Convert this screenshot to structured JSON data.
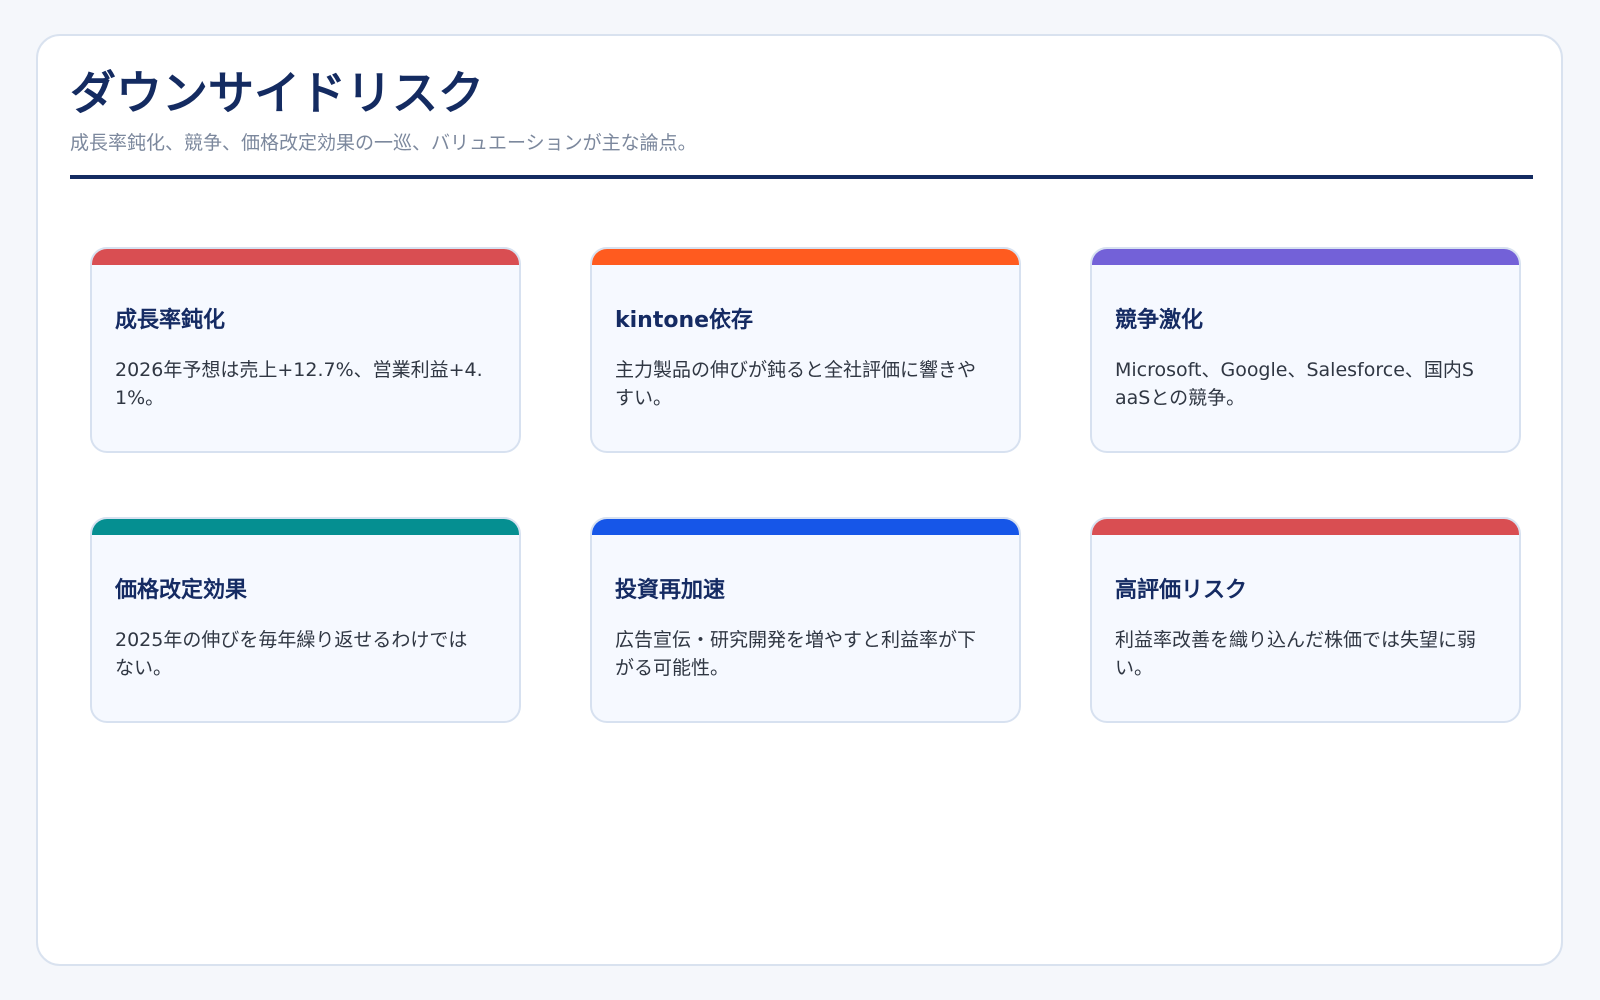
{
  "page": {
    "title": "ダウンサイドリスク",
    "subtitle": "成長率鈍化、競争、価格改定効果の一巡、バリュエーションが主な論点。"
  },
  "colors": {
    "background": "#f5f7fb",
    "panel": "#ffffff",
    "title": "#142b61",
    "subtitle": "#7c889d",
    "card_background": "#f6f9ff",
    "card_border": "#d7e1f0"
  },
  "cards": [
    {
      "title": "成長率鈍化",
      "body": "2026年予想は売上+12.7%、営業利益+4.1%。",
      "accent": "#d94e52"
    },
    {
      "title": "kintone依存",
      "body": "主力製品の伸びが鈍ると全社評価に響きやすい。",
      "accent": "#ff5b1f"
    },
    {
      "title": "競争激化",
      "body": "Microsoft、Google、Salesforce、国内SaaSとの競争。",
      "accent": "#7361d8"
    },
    {
      "title": "価格改定効果",
      "body": "2025年の伸びを毎年繰り返せるわけではない。",
      "accent": "#058f91"
    },
    {
      "title": "投資再加速",
      "body": "広告宣伝・研究開発を増やすと利益率が下がる可能性。",
      "accent": "#1656e8"
    },
    {
      "title": "高評価リスク",
      "body": "利益率改善を織り込んだ株価では失望に弱い。",
      "accent": "#d94e52"
    }
  ]
}
